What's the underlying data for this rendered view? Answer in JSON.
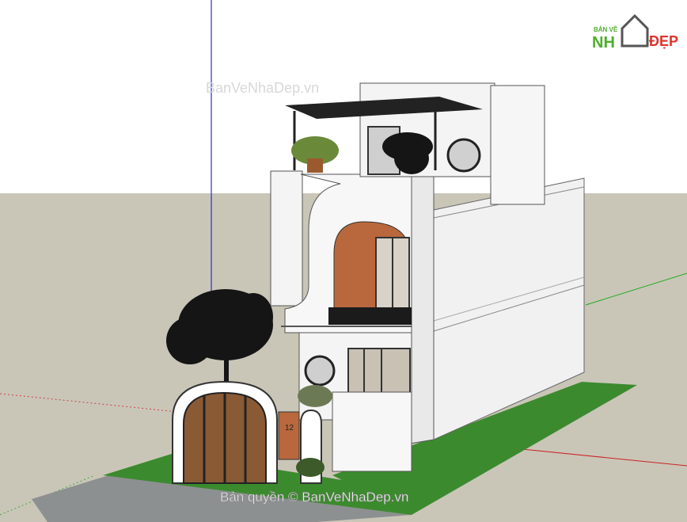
{
  "logo": {
    "top_text": "BẢN VẼ",
    "brand_left": "NH",
    "brand_right": "ĐẸP",
    "colors": {
      "green": "#4caf2a",
      "red": "#d9342b",
      "gray": "#555555"
    }
  },
  "watermarks": {
    "top": "BanVeNhaDep.vn",
    "bottom": "Bản quyền © BanVeNhaDep.vn"
  },
  "house": {
    "number_plate": "12"
  },
  "colors": {
    "sky": "#ffffff",
    "ground": "#c9c6b8",
    "grass": "#3c8a2e",
    "road": "#8d9090",
    "wall": "#f4f4f4",
    "brick": "#b8683c",
    "frame": "#333333"
  }
}
